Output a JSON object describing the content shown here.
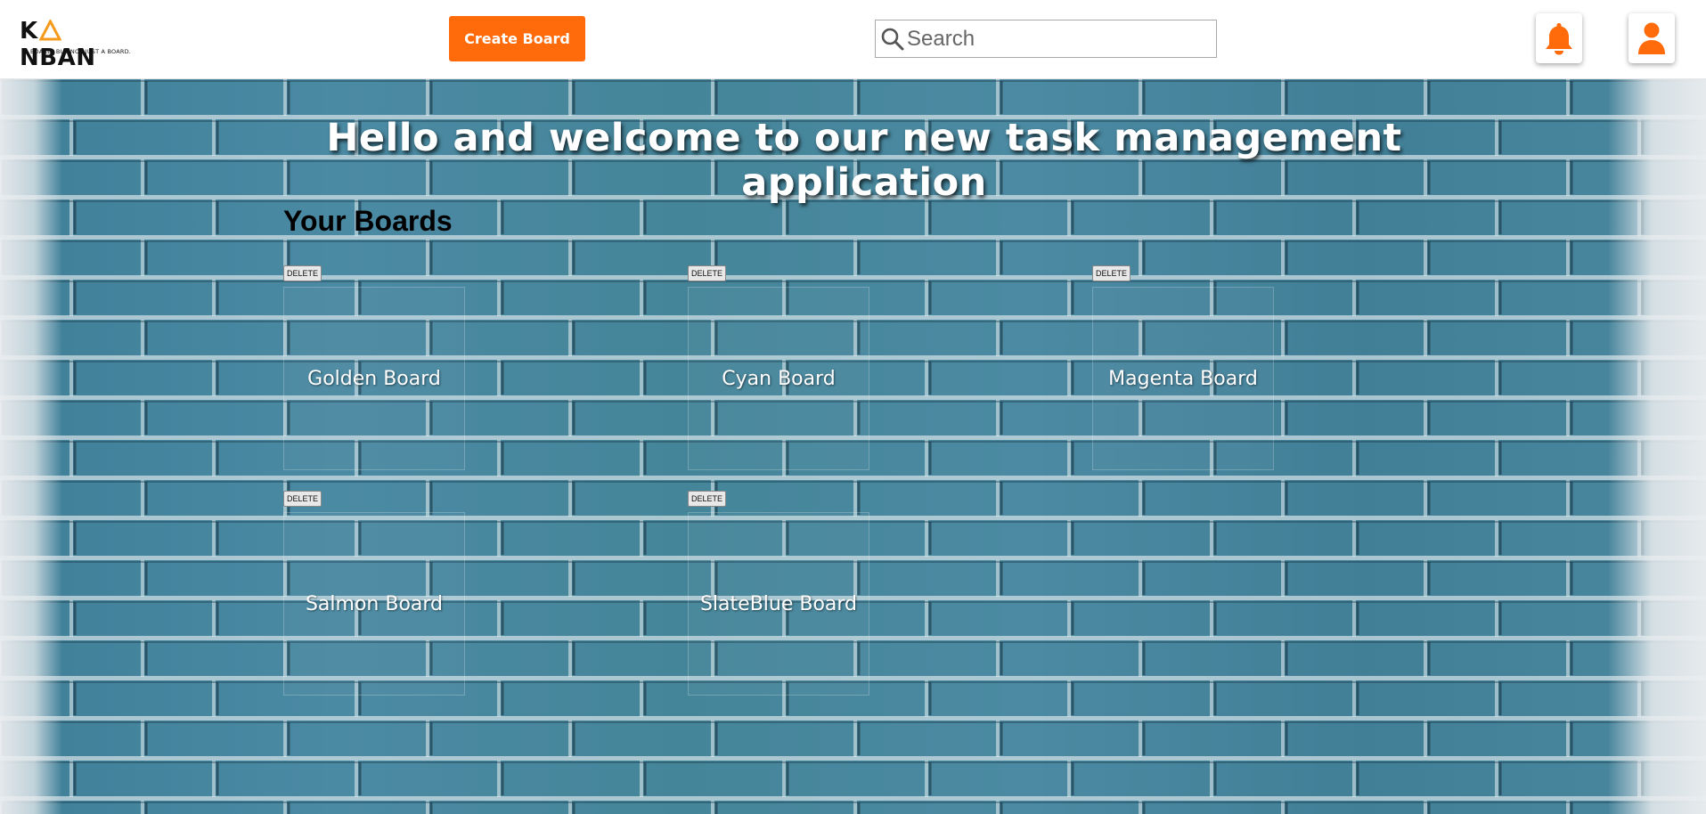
{
  "logo": {
    "text_k": "K",
    "text_rest": "NBAN",
    "tagline": "BOARD. BUT NOT JUST A BOARD."
  },
  "header": {
    "create_label": "Create Board",
    "search_placeholder": "Search",
    "bell_icon": "bell-icon",
    "user_icon": "user-icon"
  },
  "main": {
    "welcome": "Hello and welcome to our new task management application",
    "section_title": "Your Boards",
    "boards": [
      {
        "name": "Golden Board",
        "delete_label": "DELETE"
      },
      {
        "name": "Cyan Board",
        "delete_label": "DELETE"
      },
      {
        "name": "Magenta Board",
        "delete_label": "DELETE"
      },
      {
        "name": "Salmon Board",
        "delete_label": "DELETE"
      },
      {
        "name": "SlateBlue Board",
        "delete_label": "DELETE"
      }
    ]
  },
  "colors": {
    "accent": "#ff6a0b",
    "brick_blue": "#4a88a0",
    "header_bg": "#ffffff"
  }
}
